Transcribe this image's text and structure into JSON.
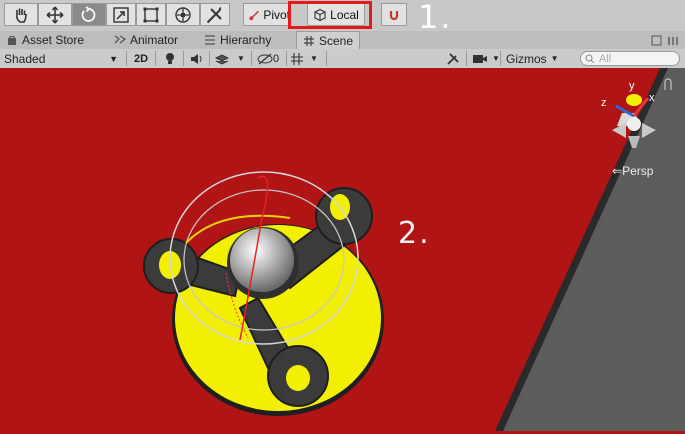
{
  "toolbar": {
    "tools": [
      "hand-tool",
      "move-tool",
      "rotate-tool",
      "scale-tool",
      "rect-tool",
      "transform-tool",
      "custom-tool"
    ],
    "pivot_label": "Pivot",
    "local_label": "Local",
    "annotation_1": "1."
  },
  "tabs": [
    {
      "label": "Asset Store"
    },
    {
      "label": "Animator"
    },
    {
      "label": "Hierarchy"
    },
    {
      "label": "Scene"
    }
  ],
  "scene_toolbar": {
    "shading_mode": "Shaded",
    "mode_2d": "2D",
    "hidden_count": "0",
    "gizmos_label": "Gizmos",
    "search_placeholder": "All"
  },
  "viewport": {
    "annotation_2": "2.",
    "persp_label": "Persp",
    "gizmo_axes": [
      "y",
      "x",
      "z"
    ],
    "background_color": "#b01414",
    "object_color": "#f2ef00",
    "handle_color": "#3b3b3b"
  }
}
